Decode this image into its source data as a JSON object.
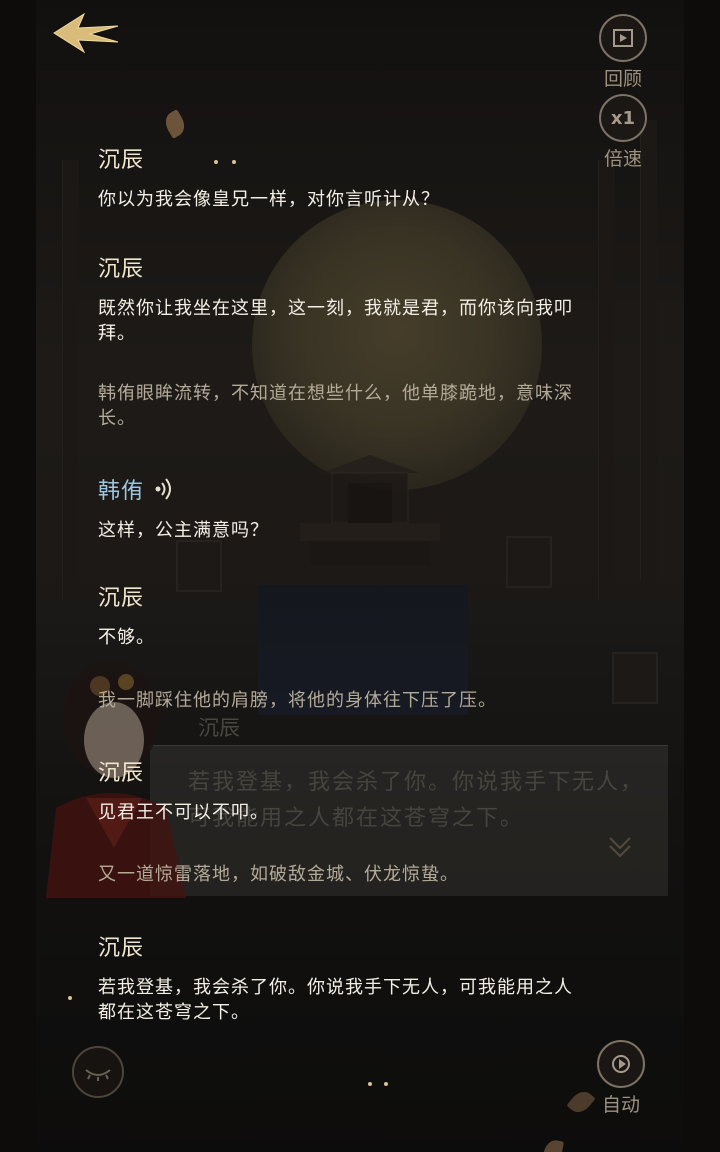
{
  "hud": {
    "review_label": "回顾",
    "speed_value": "x1",
    "speed_label": "倍速",
    "auto_label": "自动"
  },
  "underlying_dialog": {
    "speaker": "沉辰",
    "text": "若我登基，我会杀了你。你说我手下无人，可我能用之人都在这苍穹之下。"
  },
  "log": [
    {
      "type": "dialogue",
      "speaker": "沉辰",
      "text": "你以为我会像皇兄一样，对你言听计从？"
    },
    {
      "type": "dialogue",
      "speaker": "沉辰",
      "text": "既然你让我坐在这里，这一刻，我就是君，而你该向我叩拜。"
    },
    {
      "type": "narration",
      "text": "韩侑眼眸流转，不知道在想些什么，他单膝跪地，意味深长。"
    },
    {
      "type": "dialogue",
      "speaker": "韩侑",
      "text": "这样，公主满意吗？",
      "voice": true
    },
    {
      "type": "dialogue",
      "speaker": "沉辰",
      "text": "不够。"
    },
    {
      "type": "narration",
      "text": "我一脚踩住他的肩膀，将他的身体往下压了压。"
    },
    {
      "type": "dialogue",
      "speaker": "沉辰",
      "text": "见君王不可以不叩。"
    },
    {
      "type": "narration",
      "text": "又一道惊雷落地，如破敌金城、伏龙惊蛰。"
    },
    {
      "type": "dialogue",
      "speaker": "沉辰",
      "text": "若我登基，我会杀了你。你说我手下无人，可我能用之人都在这苍穹之下。"
    }
  ]
}
